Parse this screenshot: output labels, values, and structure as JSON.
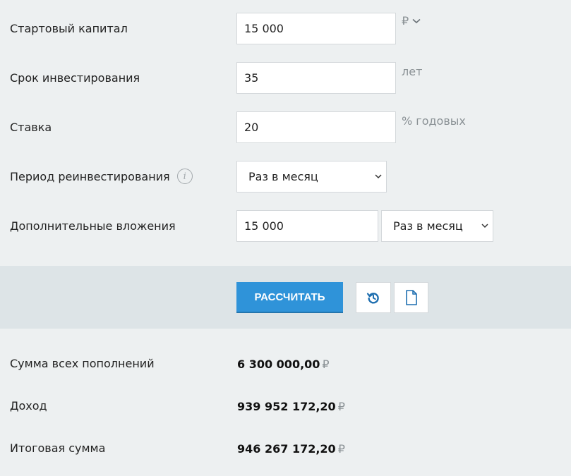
{
  "form": {
    "capital": {
      "label": "Стартовый капитал",
      "value": "15 000",
      "currency": "₽"
    },
    "term": {
      "label": "Срок инвестирования",
      "value": "35",
      "unit": "лет"
    },
    "rate": {
      "label": "Ставка",
      "value": "20",
      "unit": "% годовых"
    },
    "reinvest": {
      "label": "Период реинвестирования",
      "selected": "Раз в месяц"
    },
    "additional": {
      "label": "Дополнительные вложения",
      "value": "15 000",
      "period": "Раз в месяц"
    }
  },
  "actions": {
    "calculate_label": "РАССЧИТАТЬ"
  },
  "results": {
    "deposits": {
      "label": "Сумма всех пополнений",
      "value": "6 300 000,00",
      "currency": "₽"
    },
    "income": {
      "label": "Доход",
      "value": "939 952 172,20",
      "currency": "₽"
    },
    "total": {
      "label": "Итоговая сумма",
      "value": "946 267 172,20",
      "currency": "₽"
    }
  },
  "colors": {
    "accent": "#2f93d9",
    "background": "#edf0f1",
    "action_bar": "#dde4e7"
  },
  "icons": {
    "info": "info-icon",
    "reset": "reset-history-icon",
    "document": "document-icon",
    "currency_dropdown": "chevron-down-icon"
  }
}
